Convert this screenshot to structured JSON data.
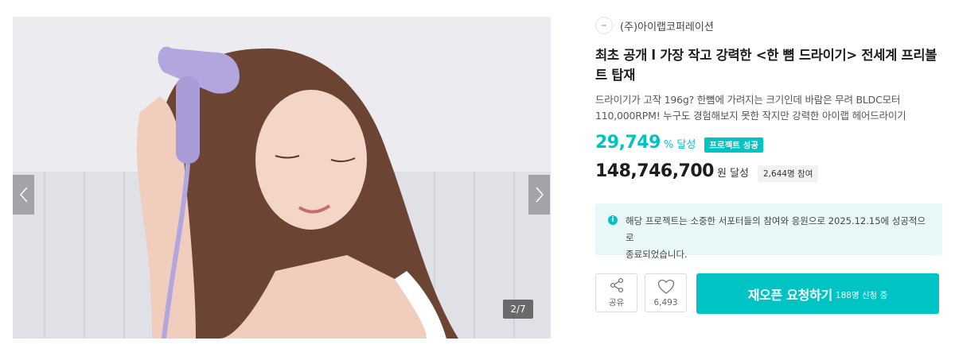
{
  "gallery": {
    "counter": "2/7",
    "prev_icon": "chevron-left-icon",
    "next_icon": "chevron-right-icon"
  },
  "maker": {
    "name": "(주)아이랩코퍼레이션"
  },
  "project": {
    "title": "최초 공개 l 가장 작고 강력한 <한 뼘 드라이기> 전세계 프리볼트 탑재",
    "description": "드라이기가 고작 196g? 한뼘에 가려지는 크기인데 바람은 무려 BLDC모터 110,000RPM! 누구도 경험해보지 못한 작지만 강력한 아이랩 헤어드라이기"
  },
  "stats": {
    "achievement_rate": "29,749",
    "achievement_unit": "% 달성",
    "success_badge": "프로젝트 성공",
    "amount": "148,746,700",
    "amount_unit": "원 달성",
    "supporters": "2,644명 참여"
  },
  "notice": {
    "line1": "해당 프로젝트는 소중한 서포터들의 참여와 응원으로 2025.12.15에 성공적으로",
    "line2": "종료되었습니다."
  },
  "actions": {
    "share_label": "공유",
    "like_count": "6,493",
    "reopen_label": "재오픈 요청하기",
    "reopen_sub": "188명 신청 중"
  },
  "colors": {
    "accent": "#00c4c4",
    "notice_bg": "#e8f8f8",
    "dryer": "#b3a6de"
  }
}
